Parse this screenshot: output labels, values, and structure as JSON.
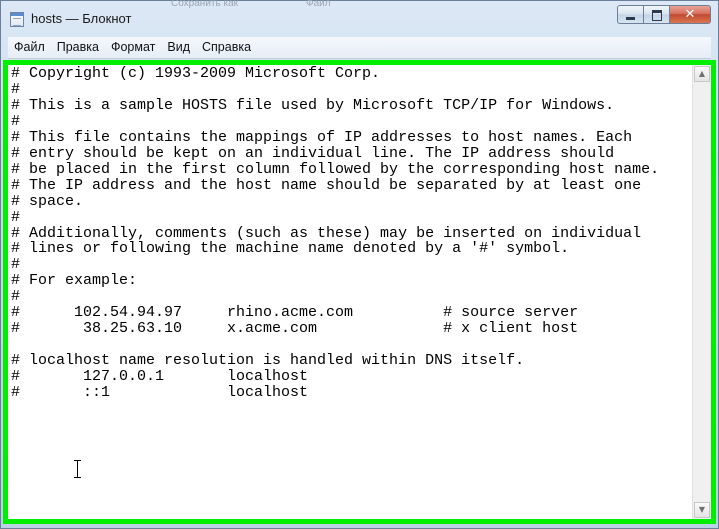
{
  "window": {
    "title": "hosts — Блокнот",
    "background_ghost_text": [
      "Сохранить как",
      "Файл"
    ]
  },
  "menu": {
    "items": [
      "Файл",
      "Правка",
      "Формат",
      "Вид",
      "Справка"
    ]
  },
  "editor": {
    "lines": [
      "# Copyright (c) 1993-2009 Microsoft Corp.",
      "#",
      "# This is a sample HOSTS file used by Microsoft TCP/IP for Windows.",
      "#",
      "# This file contains the mappings of IP addresses to host names. Each",
      "# entry should be kept on an individual line. The IP address should",
      "# be placed in the first column followed by the corresponding host name.",
      "# The IP address and the host name should be separated by at least one",
      "# space.",
      "#",
      "# Additionally, comments (such as these) may be inserted on individual",
      "# lines or following the machine name denoted by a '#' symbol.",
      "#",
      "# For example:",
      "#",
      "#      102.54.94.97     rhino.acme.com          # source server",
      "#       38.25.63.10     x.acme.com              # x client host",
      "",
      "# localhost name resolution is handled within DNS itself.",
      "#       127.0.0.1       localhost",
      "#       ::1             localhost"
    ]
  },
  "colors": {
    "highlight_border": "#00ee00",
    "close_button": "#c24a33"
  },
  "icons": {
    "app": "notepad-icon",
    "minimize": "minimize-icon",
    "maximize": "maximize-icon",
    "close": "close-icon",
    "scroll_up": "arrow-up-icon",
    "scroll_down": "arrow-down-icon",
    "cursor": "text-cursor-icon"
  }
}
